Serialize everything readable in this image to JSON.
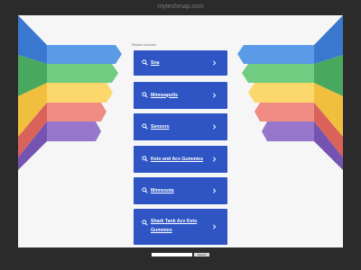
{
  "page": {
    "domain": "mytechmap.com"
  },
  "related": {
    "heading": "Related searches",
    "links": [
      {
        "label": "Sna"
      },
      {
        "label": "Minneapolis"
      },
      {
        "label": "Sensors"
      },
      {
        "label": "Keto and Acv Gummies"
      },
      {
        "label": "Minnesota"
      },
      {
        "label": "Shark Tank Acv Keto Gummies"
      }
    ]
  },
  "search": {
    "placeholder": "",
    "button_label": "Search"
  },
  "footer": {
    "note": ""
  },
  "ribbon_colors": [
    "#4d8fe4",
    "#64c476",
    "#fbd45f",
    "#ed7f77",
    "#8b6bc0"
  ],
  "link_color": "#2f55c5"
}
